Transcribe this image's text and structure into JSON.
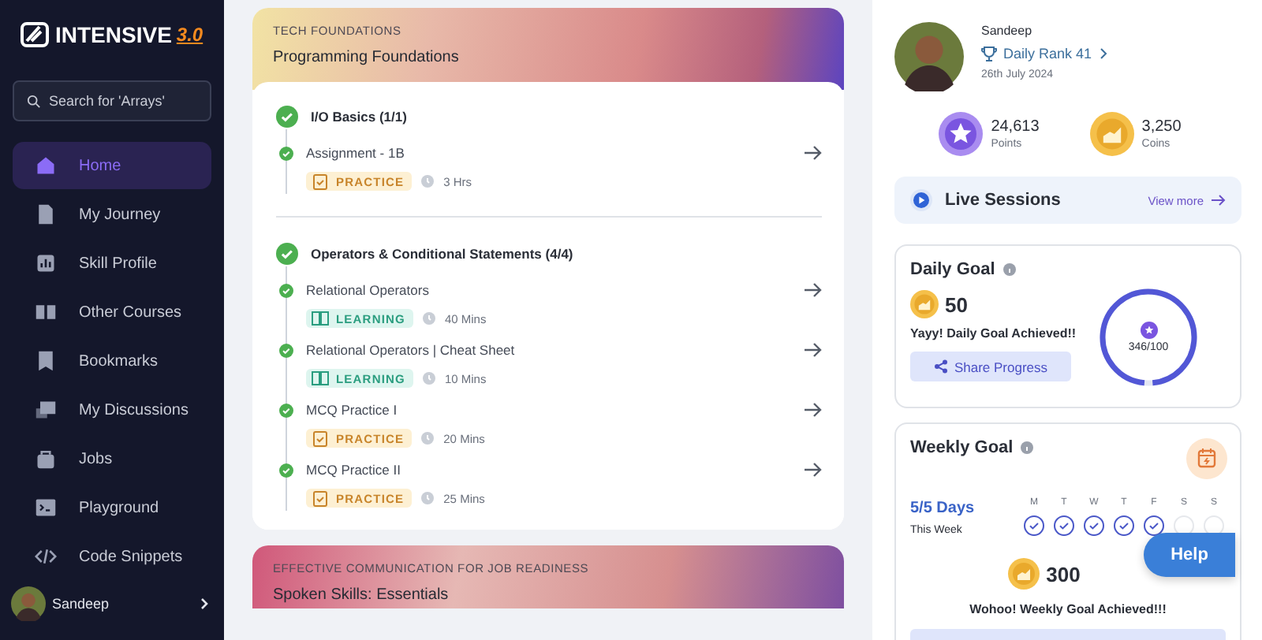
{
  "logo": {
    "text": "INTENSIVE",
    "version": "3.0"
  },
  "search": {
    "placeholder": "Search for 'Arrays'"
  },
  "sidebar": {
    "items": [
      {
        "label": "Home",
        "selected": true
      },
      {
        "label": "My Journey",
        "selected": false
      },
      {
        "label": "Skill Profile",
        "selected": false
      },
      {
        "label": "Other Courses",
        "selected": false
      },
      {
        "label": "Bookmarks",
        "selected": false
      },
      {
        "label": "My Discussions",
        "selected": false
      },
      {
        "label": "Jobs",
        "selected": false
      },
      {
        "label": "Playground",
        "selected": false
      },
      {
        "label": "Code Snippets",
        "selected": false
      }
    ],
    "user": {
      "name": "Sandeep"
    }
  },
  "courses": [
    {
      "category": "TECH FOUNDATIONS",
      "title": "Programming Foundations",
      "topics": [
        {
          "title": "I/O Basics (1/1)",
          "completed": true,
          "units": [
            {
              "title": "Assignment - 1B",
              "completed": true,
              "kind": "practice",
              "tag": "PRACTICE",
              "duration": "3 Hrs"
            }
          ]
        },
        {
          "title": "Operators & Conditional Statements (4/4)",
          "completed": true,
          "units": [
            {
              "title": "Relational Operators",
              "completed": true,
              "kind": "learning",
              "tag": "LEARNING",
              "duration": "40 Mins"
            },
            {
              "title": "Relational Operators | Cheat Sheet",
              "completed": true,
              "kind": "learning",
              "tag": "LEARNING",
              "duration": "10 Mins"
            },
            {
              "title": "MCQ Practice I",
              "completed": true,
              "kind": "practice",
              "tag": "PRACTICE",
              "duration": "20 Mins"
            },
            {
              "title": "MCQ Practice II",
              "completed": true,
              "kind": "practice",
              "tag": "PRACTICE",
              "duration": "25 Mins"
            }
          ]
        }
      ]
    },
    {
      "category": "EFFECTIVE COMMUNICATION FOR JOB READINESS",
      "title": "Spoken Skills: Essentials"
    }
  ],
  "profile": {
    "name": "Sandeep",
    "rank": "Daily Rank 41",
    "date": "26th July 2024",
    "stats": [
      {
        "kind": "points",
        "value": "24,613",
        "label": "Points"
      },
      {
        "kind": "coins",
        "value": "3,250",
        "label": "Coins"
      }
    ]
  },
  "live_sessions": {
    "title": "Live Sessions",
    "link": "View more"
  },
  "daily_goal": {
    "title": "Daily Goal",
    "coins": "50",
    "message": "Yayy! Daily Goal Achieved!!",
    "button": "Share Progress",
    "progress": "346/100",
    "level": 1
  },
  "weekly_goal": {
    "title": "Weekly Goal",
    "days": "5/5 Days",
    "subtitle": "This Week",
    "week": [
      {
        "label": "M",
        "done": true
      },
      {
        "label": "T",
        "done": true
      },
      {
        "label": "W",
        "done": true
      },
      {
        "label": "T",
        "done": true
      },
      {
        "label": "F",
        "done": true
      },
      {
        "label": "S",
        "done": false
      },
      {
        "label": "S",
        "done": false
      }
    ],
    "coins": "300",
    "message": "Wohoo! Weekly Goal Achieved!!!"
  },
  "help": {
    "label": "Help"
  }
}
